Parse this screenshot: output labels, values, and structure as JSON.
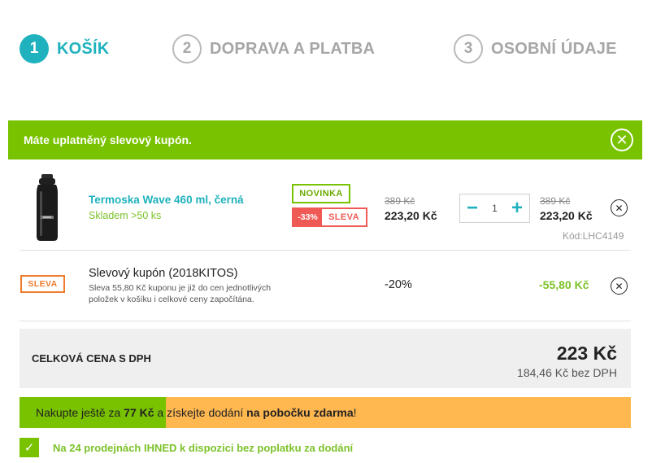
{
  "steps": [
    {
      "num": "1",
      "label": "KOŠÍK"
    },
    {
      "num": "2",
      "label": "DOPRAVA A PLATBA"
    },
    {
      "num": "3",
      "label": "OSOBNÍ ÚDAJE"
    }
  ],
  "coupon_banner": {
    "text": "Máte uplatněný slevový kupón.",
    "close_glyph": "✕"
  },
  "product": {
    "name": "Termoska Wave 460 ml, černá",
    "stock": "Skladem >50 ks",
    "badge_new": "NOVINKA",
    "badge_discount_pct": "-33%",
    "badge_discount_label": "SLEVA",
    "unit_price_old": "389 Kč",
    "unit_price_new": "223,20 Kč",
    "qty_minus": "−",
    "qty_value": "1",
    "qty_plus": "+",
    "total_price_old": "389 Kč",
    "total_price_new": "223,20 Kč",
    "code": "Kód:LHC4149",
    "remove_glyph": "✕"
  },
  "coupon": {
    "badge": "SLEVA",
    "title": "Slevový kupón (2018KITOS)",
    "description": "Sleva 55,80 Kč kuponu je již do cen jednotlivých položek v košíku i celkové ceny započítána.",
    "percent": "-20%",
    "amount": "-55,80 Kč",
    "remove_glyph": "✕"
  },
  "total": {
    "label": "CELKOVÁ CENA S DPH",
    "price": "223 Kč",
    "price_without_vat": "184,46 Kč bez DPH"
  },
  "free_shipping": {
    "progress": 0.24,
    "prefix": "Nakupte ještě za ",
    "amount": "77 Kč",
    "middle": " a získejte dodání ",
    "highlight": "na pobočku zdarma",
    "suffix": "!"
  },
  "availability": {
    "checked_glyph": "✓",
    "text": "Na 24 prodejnách IHNED k dispozici bez poplatku za dodání"
  },
  "colors": {
    "teal": "#1fb2be",
    "green": "#79c200",
    "orange": "#ffb750",
    "red": "#ef5a55"
  }
}
